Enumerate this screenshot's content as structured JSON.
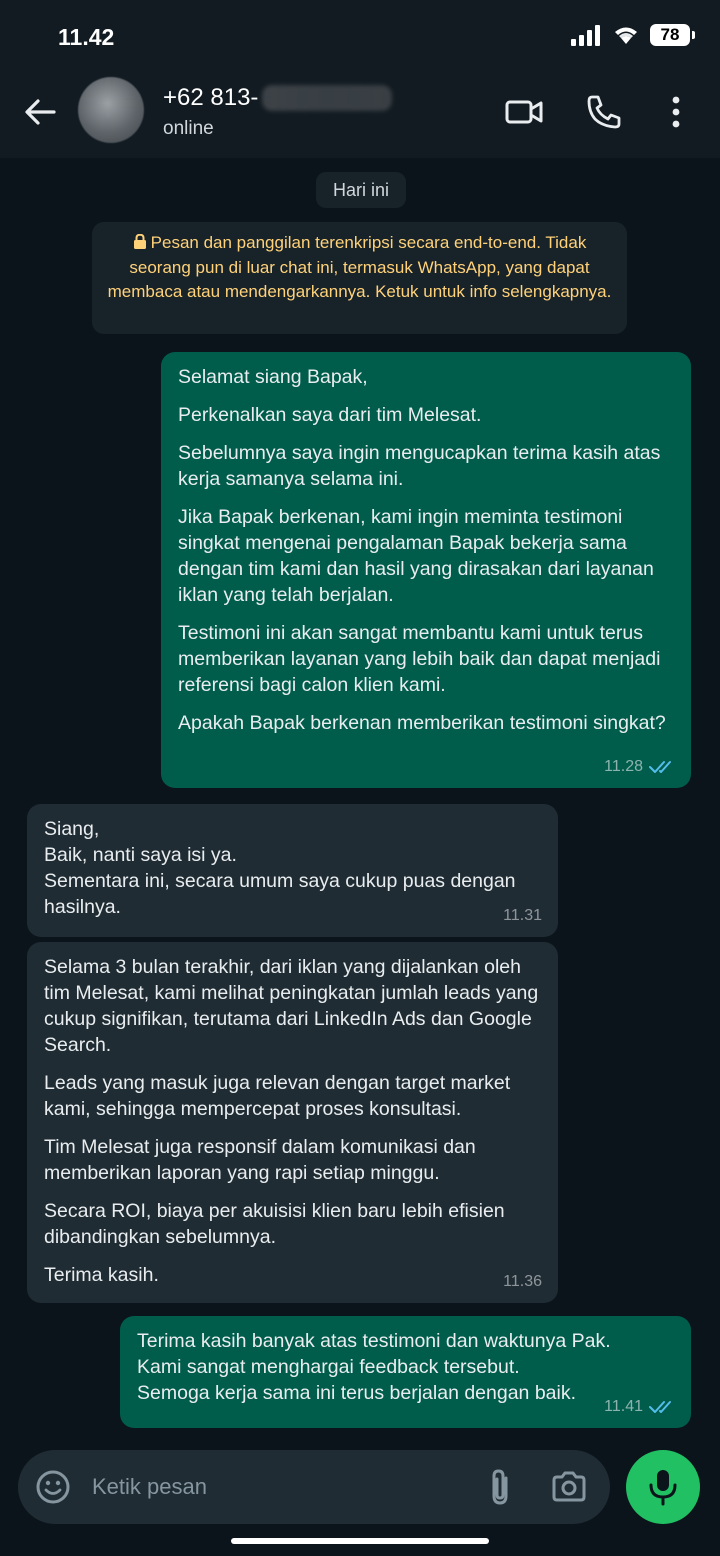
{
  "status_bar": {
    "time": "11.42",
    "battery": "78"
  },
  "header": {
    "contact_number": "+62 813-",
    "status": "online"
  },
  "date_chip": "Hari ini",
  "encryption_notice": "Pesan dan panggilan terenkripsi secara end-to-end. Tidak seorang pun di luar chat ini, termasuk WhatsApp, yang dapat membaca atau mendengarkannya. Ketuk untuk info selengkapnya.",
  "messages": [
    {
      "direction": "outgoing",
      "paragraphs": [
        "Selamat siang Bapak,",
        "Perkenalkan saya dari tim Melesat.",
        "Sebelumnya saya ingin mengucapkan terima kasih atas kerja samanya selama ini.",
        "Jika Bapak berkenan, kami ingin meminta testimoni singkat mengenai pengalaman Bapak bekerja sama dengan tim kami dan hasil yang dirasakan dari layanan iklan yang telah berjalan.",
        "Testimoni ini akan sangat membantu kami untuk terus memberikan layanan yang lebih baik dan dapat menjadi referensi bagi calon klien kami.",
        "Apakah Bapak berkenan memberikan testimoni singkat?"
      ],
      "time": "11.28"
    },
    {
      "direction": "incoming",
      "paragraphs": [
        "Siang,",
        "Baik, nanti saya isi ya.",
        "Sementara ini, secara umum saya cukup puas dengan hasilnya."
      ],
      "time": "11.31"
    },
    {
      "direction": "incoming",
      "paragraphs": [
        "Selama 3 bulan terakhir, dari iklan yang dijalankan oleh tim Melesat, kami melihat peningkatan jumlah leads yang cukup signifikan, terutama dari LinkedIn Ads dan Google Search.",
        "Leads yang masuk juga relevan dengan target market kami, sehingga mempercepat proses konsultasi.",
        "Tim Melesat juga responsif dalam komunikasi dan memberikan laporan yang rapi setiap minggu.",
        "Secara ROI, biaya per akuisisi klien baru lebih efisien dibandingkan sebelumnya.",
        "Terima kasih."
      ],
      "time": "11.36"
    },
    {
      "direction": "outgoing",
      "paragraphs": [
        "Terima kasih banyak atas testimoni dan waktunya Pak.",
        "Kami sangat menghargai feedback tersebut.",
        "Semoga kerja sama ini terus berjalan dengan baik."
      ],
      "time": "11.41"
    }
  ],
  "composer": {
    "placeholder": "Ketik pesan"
  },
  "icons": {
    "back": "arrow-left-icon",
    "video": "video-camera-icon",
    "call": "phone-icon",
    "menu": "more-vertical-icon",
    "lock": "lock-icon",
    "read_receipt": "double-check-icon",
    "emoji": "smiley-icon",
    "attach": "paperclip-icon",
    "camera": "camera-icon",
    "mic": "microphone-icon"
  },
  "colors": {
    "background": "#0b141a",
    "header": "#121b22",
    "outgoing_bubble": "#005c4b",
    "incoming_bubble": "#1f2c33",
    "notice_text": "#ffd279",
    "read_check": "#53bdeb",
    "mic_button": "#21c063"
  }
}
